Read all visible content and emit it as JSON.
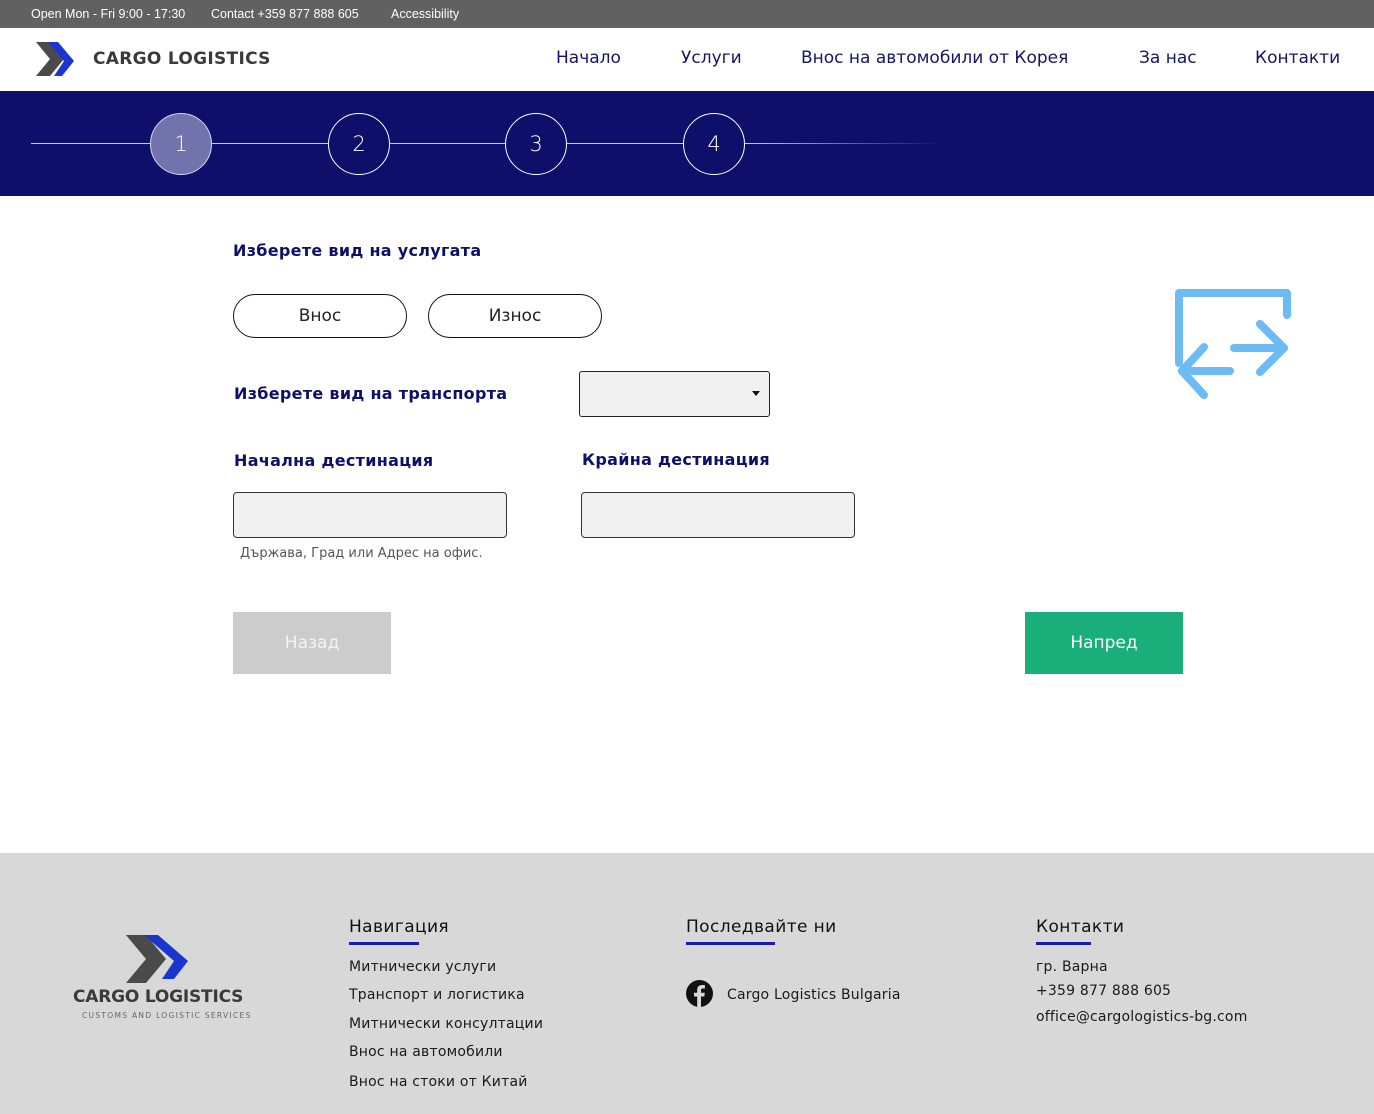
{
  "topbar": {
    "hours": "Open Mon - Fri 9:00 - 17:30",
    "contact": "Contact +359 877 888 605",
    "accessibility": "Accessibility"
  },
  "header": {
    "logo_text": "CARGO LOGISTICS",
    "nav": [
      {
        "label": "Начало"
      },
      {
        "label": "Услуги"
      },
      {
        "label": "Внос на автомобили от Корея"
      },
      {
        "label": "За нас"
      },
      {
        "label": "Контакти"
      }
    ]
  },
  "stepper": {
    "steps": [
      "1",
      "2",
      "3",
      "4"
    ],
    "active_step": 1
  },
  "form": {
    "service_label": "Изберете вид на услугата",
    "service_options": [
      "Внос",
      "Износ"
    ],
    "transport_label": "Изберете вид на транспорта",
    "transport_selected": "",
    "origin_label": "Начална дестинация",
    "origin_value": "",
    "origin_hint": "Държава, Град или Адрес на офис.",
    "destination_label": "Крайна дестинация",
    "destination_value": "",
    "back_button": "Назад",
    "next_button": "Напред",
    "illustration_icon": "exchange-arrows-icon"
  },
  "footer": {
    "logo_text": "CARGO LOGISTICS",
    "logo_tagline": "CUSTOMS AND LOGISTIC SERVICES",
    "navigation": {
      "heading": "Навигация",
      "links": [
        "Митнически услуги",
        "Транспорт и логистика",
        "Митнически консултации",
        "Внос на автомобили",
        "Внос на стоки от Китай"
      ]
    },
    "follow": {
      "heading": "Последвайте ни",
      "facebook_label": "Cargo Logistics Bulgaria",
      "icon": "facebook-icon"
    },
    "contacts": {
      "heading": "Контакти",
      "city": "гр. Варна",
      "phone": "+359 877 888 605",
      "email": "office@cargologistics-bg.com"
    }
  },
  "colors": {
    "brand_navy": "#0e0e6b",
    "active_step": "#7272ad",
    "next_green": "#1aae7a",
    "back_gray": "#cccccc",
    "icon_blue": "#6cbcf3",
    "topbar_gray": "#616161",
    "footer_gray": "#d8d8d8"
  }
}
